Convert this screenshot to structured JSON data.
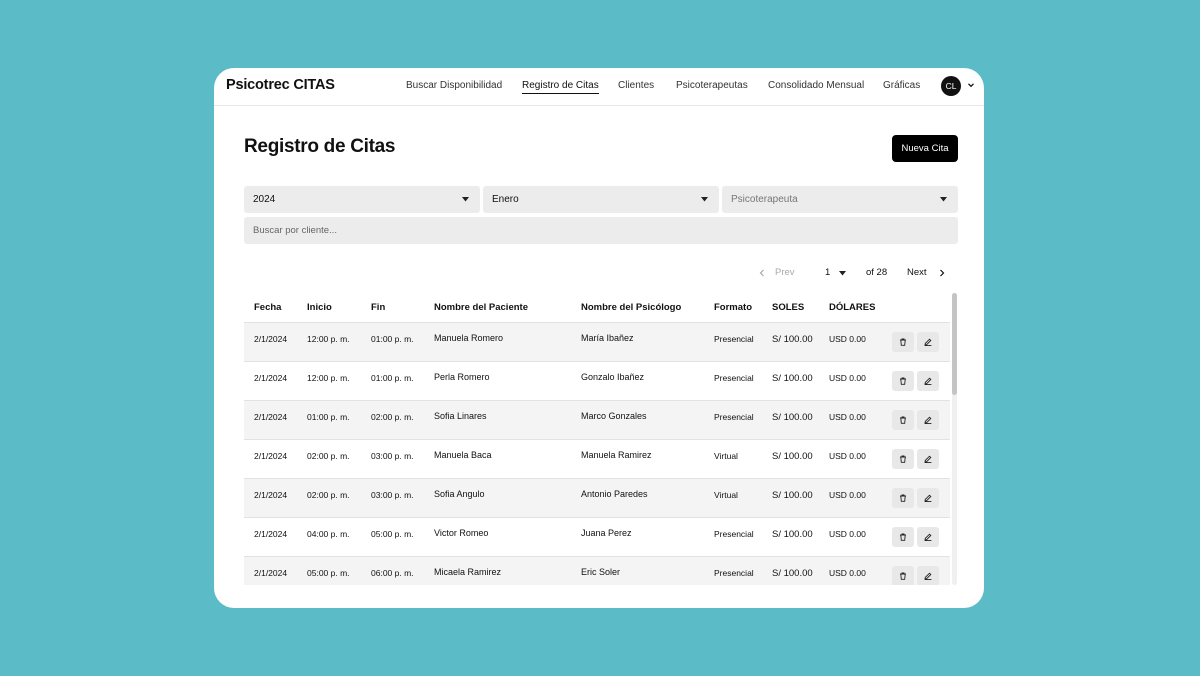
{
  "app": {
    "brand": "Psicotrec CITAS"
  },
  "nav": {
    "items": [
      {
        "label": "Buscar Disponibilidad",
        "active": false
      },
      {
        "label": "Registro de Citas",
        "active": true
      },
      {
        "label": "Clientes",
        "active": false
      },
      {
        "label": "Psicoterapeutas",
        "active": false
      },
      {
        "label": "Consolidado Mensual",
        "active": false
      },
      {
        "label": "Gráficas",
        "active": false
      }
    ],
    "user_initials": "CL"
  },
  "page": {
    "title": "Registro de Citas",
    "new_button": "Nueva Cita"
  },
  "filters": {
    "year": "2024",
    "month": "Enero",
    "therapist_placeholder": "Psicoterapeuta",
    "search_placeholder": "Buscar por cliente..."
  },
  "pagination": {
    "prev": "Prev",
    "page": "1",
    "of": "of 28",
    "next": "Next"
  },
  "table": {
    "columns": [
      "Fecha",
      "Inicio",
      "Fin",
      "Nombre del Paciente",
      "Nombre del Psicólogo",
      "Formato",
      "SOLES",
      "DÓLARES"
    ],
    "rows": [
      {
        "fecha": "2/1/2024",
        "inicio": "12:00 p. m.",
        "fin": "01:00 p. m.",
        "paciente": "Manuela Romero",
        "psicologo": "María Ibañez",
        "formato": "Presencial",
        "soles": "S/ 100.00",
        "dolares": "USD 0.00"
      },
      {
        "fecha": "2/1/2024",
        "inicio": "12:00 p. m.",
        "fin": "01:00 p. m.",
        "paciente": "Perla Romero",
        "psicologo": "Gonzalo Ibañez",
        "formato": "Presencial",
        "soles": "S/ 100.00",
        "dolares": "USD 0.00"
      },
      {
        "fecha": "2/1/2024",
        "inicio": "01:00 p. m.",
        "fin": "02:00 p. m.",
        "paciente": "Sofia Linares",
        "psicologo": "Marco Gonzales",
        "formato": "Presencial",
        "soles": "S/ 100.00",
        "dolares": "USD 0.00"
      },
      {
        "fecha": "2/1/2024",
        "inicio": "02:00 p. m.",
        "fin": "03:00 p. m.",
        "paciente": "Manuela Baca",
        "psicologo": "Manuela Ramirez",
        "formato": "Virtual",
        "soles": "S/ 100.00",
        "dolares": "USD 0.00"
      },
      {
        "fecha": "2/1/2024",
        "inicio": "02:00 p. m.",
        "fin": "03:00 p. m.",
        "paciente": "Sofia Angulo",
        "psicologo": "Antonio Paredes",
        "formato": "Virtual",
        "soles": "S/ 100.00",
        "dolares": "USD 0.00"
      },
      {
        "fecha": "2/1/2024",
        "inicio": "04:00 p. m.",
        "fin": "05:00 p. m.",
        "paciente": "Victor Romeo",
        "psicologo": "Juana Perez",
        "formato": "Presencial",
        "soles": "S/ 100.00",
        "dolares": "USD 0.00"
      },
      {
        "fecha": "2/1/2024",
        "inicio": "05:00 p. m.",
        "fin": "06:00 p. m.",
        "paciente": "Micaela Ramirez",
        "psicologo": "Eric Soler",
        "formato": "Presencial",
        "soles": "S/ 100.00",
        "dolares": "USD 0.00"
      }
    ],
    "row_icons": {
      "delete": "trash-icon",
      "edit": "pencil-icon"
    }
  },
  "colors": {
    "background": "#5bbcc8",
    "accent": "#000000",
    "field": "#ececec"
  }
}
